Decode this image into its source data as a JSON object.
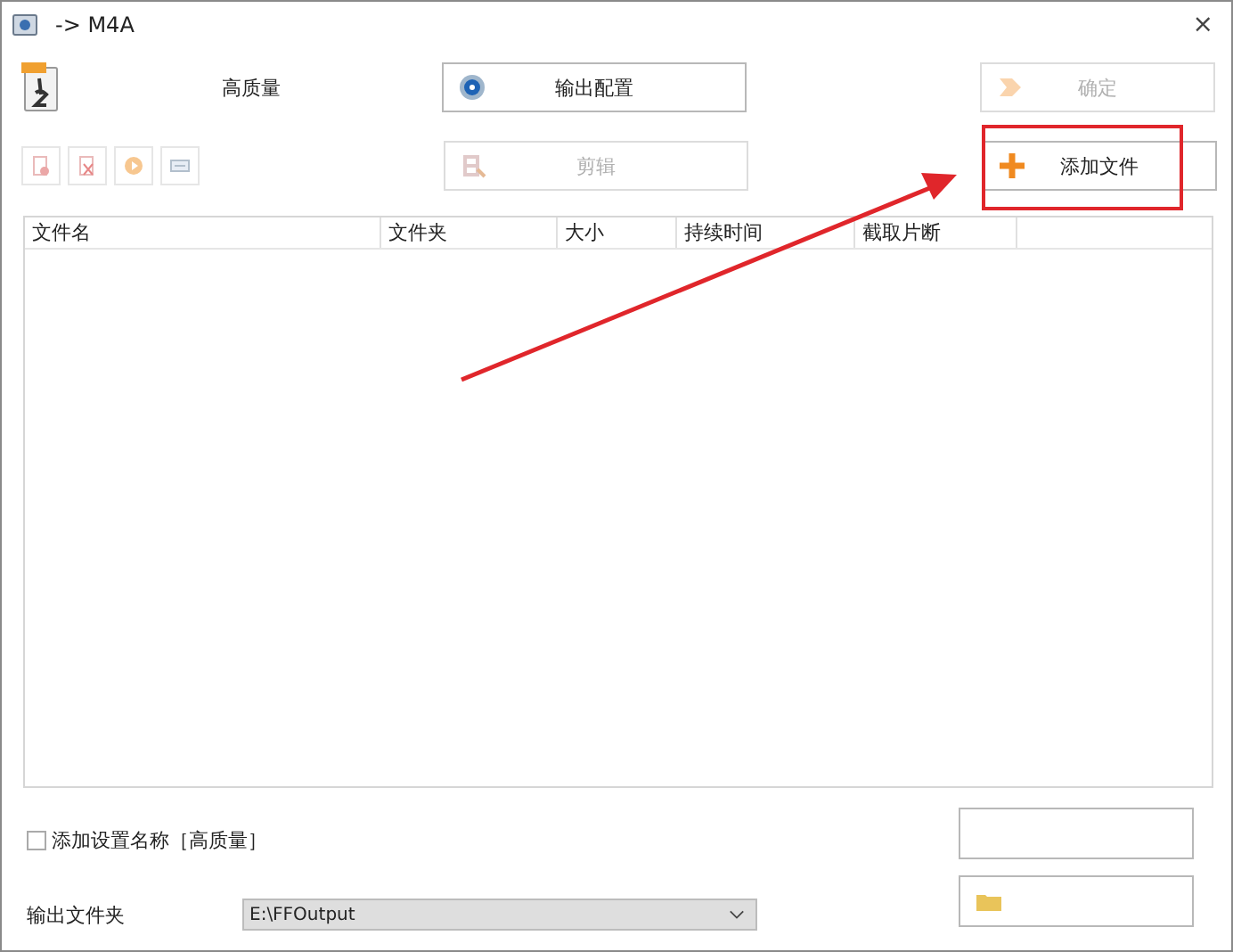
{
  "window": {
    "title": "-> M4A",
    "close": "×"
  },
  "preset": {
    "label": "高质量"
  },
  "output_config_button": {
    "label": "输出配置",
    "disabled": false
  },
  "confirm_button": {
    "label": "确定",
    "disabled": true
  },
  "tool_buttons": [
    {
      "kind": "remove",
      "disabled": true
    },
    {
      "kind": "clear",
      "disabled": true
    },
    {
      "kind": "play",
      "disabled": true
    },
    {
      "kind": "info",
      "disabled": true
    }
  ],
  "clip_button": {
    "label": "剪辑",
    "disabled": true
  },
  "add_files_button": {
    "label": "添加文件",
    "disabled": false
  },
  "table": {
    "columns": [
      "文件名",
      "文件夹",
      "大小",
      "持续时间",
      "截取片断"
    ]
  },
  "add_preset_name": {
    "label": "添加设置名称［高质量］",
    "checked": false
  },
  "output_folder": {
    "label": "输出文件夹",
    "value": "E:\\FFOutput"
  }
}
